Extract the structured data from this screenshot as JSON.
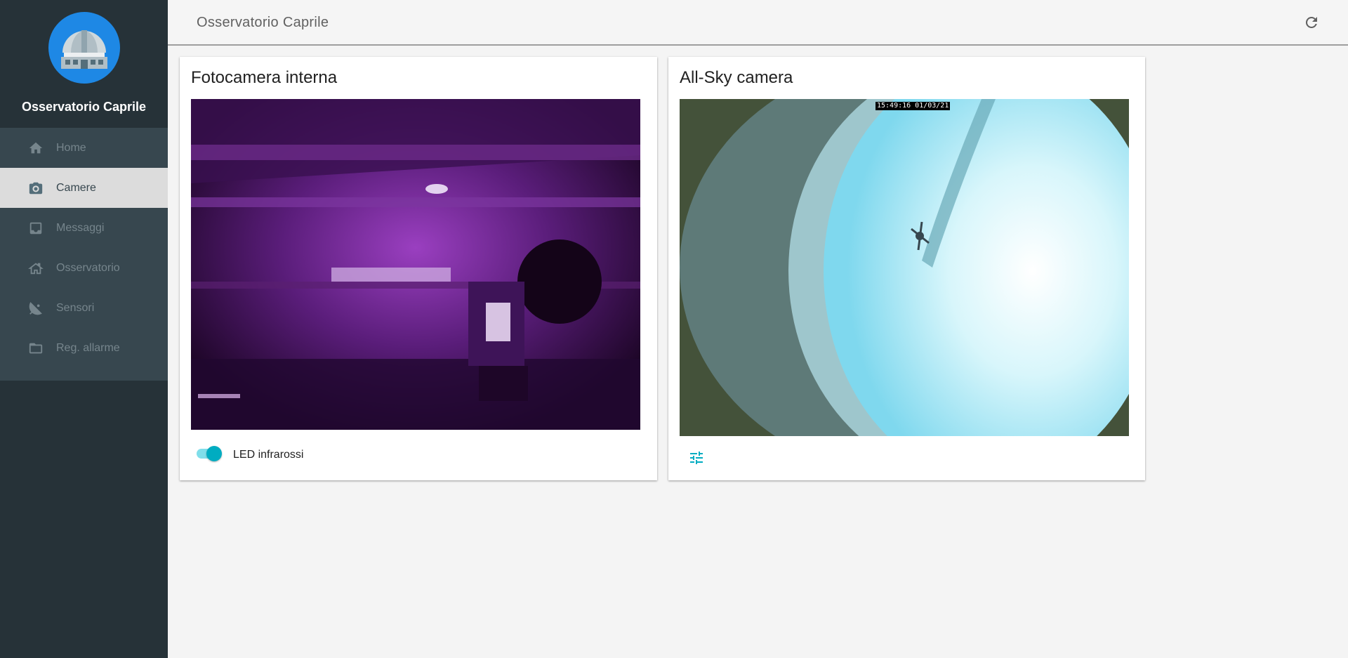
{
  "app": {
    "name": "Osservatorio Caprile",
    "header_title": "Osservatorio Caprile"
  },
  "sidebar": {
    "items": [
      {
        "label": "Home",
        "icon": "home-icon",
        "active": false
      },
      {
        "label": "Camere",
        "icon": "camera-icon",
        "active": true
      },
      {
        "label": "Messaggi",
        "icon": "inbox-icon",
        "active": false
      },
      {
        "label": "Osservatorio",
        "icon": "observatory-icon",
        "active": false
      },
      {
        "label": "Sensori",
        "icon": "satellite-dish-icon",
        "active": false
      },
      {
        "label": "Reg. allarme",
        "icon": "folder-icon",
        "active": false
      }
    ]
  },
  "header": {
    "refresh_icon": "refresh-icon"
  },
  "cards": {
    "internal": {
      "title": "Fotocamera interna",
      "toggle_label": "LED infrarossi",
      "toggle_on": true
    },
    "allsky": {
      "title": "All-Sky camera",
      "timestamp": "15:49:16 01/03/21",
      "settings_icon": "tune-icon"
    }
  },
  "colors": {
    "sidebar": "#263238",
    "nav": "#37474f",
    "accent": "#00acc1",
    "logo_bg": "#1e88e5"
  }
}
